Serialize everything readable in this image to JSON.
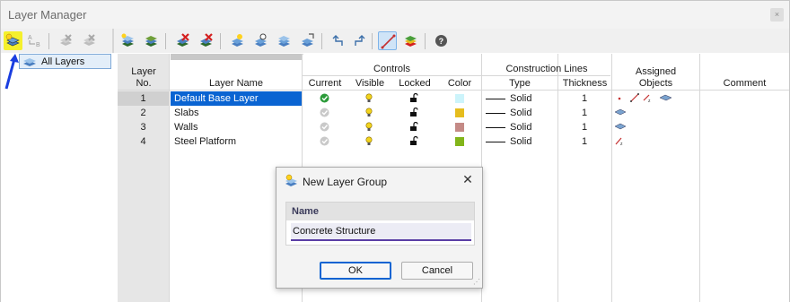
{
  "window": {
    "title": "Layer Manager",
    "close_glyph": "×"
  },
  "tree": {
    "item_label": "All Layers"
  },
  "table": {
    "columns": {
      "layer_no": "Layer\nNo.",
      "layer_name": "Layer Name",
      "controls_group": "Controls",
      "current": "Current",
      "visible": "Visible",
      "locked": "Locked",
      "color": "Color",
      "construction_group": "Construction Lines",
      "type": "Type",
      "thickness": "Thickness",
      "assigned_group": "Assigned",
      "objects": "Objects",
      "comment": "Comment"
    },
    "rows": [
      {
        "no": "1",
        "name": "Default Base Layer",
        "current": true,
        "color": "#ccf4fb",
        "type": "Solid",
        "thickness": "1",
        "objects": "nodes-lines-members-surfaces"
      },
      {
        "no": "2",
        "name": "Slabs",
        "current": false,
        "color": "#e6bd1e",
        "type": "Solid",
        "thickness": "1",
        "objects": "surfaces"
      },
      {
        "no": "3",
        "name": "Walls",
        "current": false,
        "color": "#c48a86",
        "type": "Solid",
        "thickness": "1",
        "objects": "surfaces"
      },
      {
        "no": "4",
        "name": "Steel Platform",
        "current": false,
        "color": "#82b51a",
        "type": "Solid",
        "thickness": "1",
        "objects": "members"
      }
    ]
  },
  "dialog": {
    "title": "New Layer Group",
    "close_glyph": "✕",
    "group_label": "Name",
    "name_value": "Concrete Structure",
    "ok_label": "OK",
    "cancel_label": "Cancel"
  },
  "icons": {
    "toolbar_left": [
      "new-layer-group-icon",
      "rename-icon",
      "delete-group-icon",
      "delete-group-all-icon"
    ],
    "toolbar_right": [
      "new-layer-icon",
      "copy-layer-icon",
      "delete-layer-icon",
      "delete-all-layers-icon",
      "assign-icon",
      "assign-selected-icon",
      "merge-icon",
      "export-icon",
      "undo-icon",
      "redo-icon",
      "show-construction-lines-icon",
      "color-layers-icon",
      "help-icon"
    ]
  }
}
